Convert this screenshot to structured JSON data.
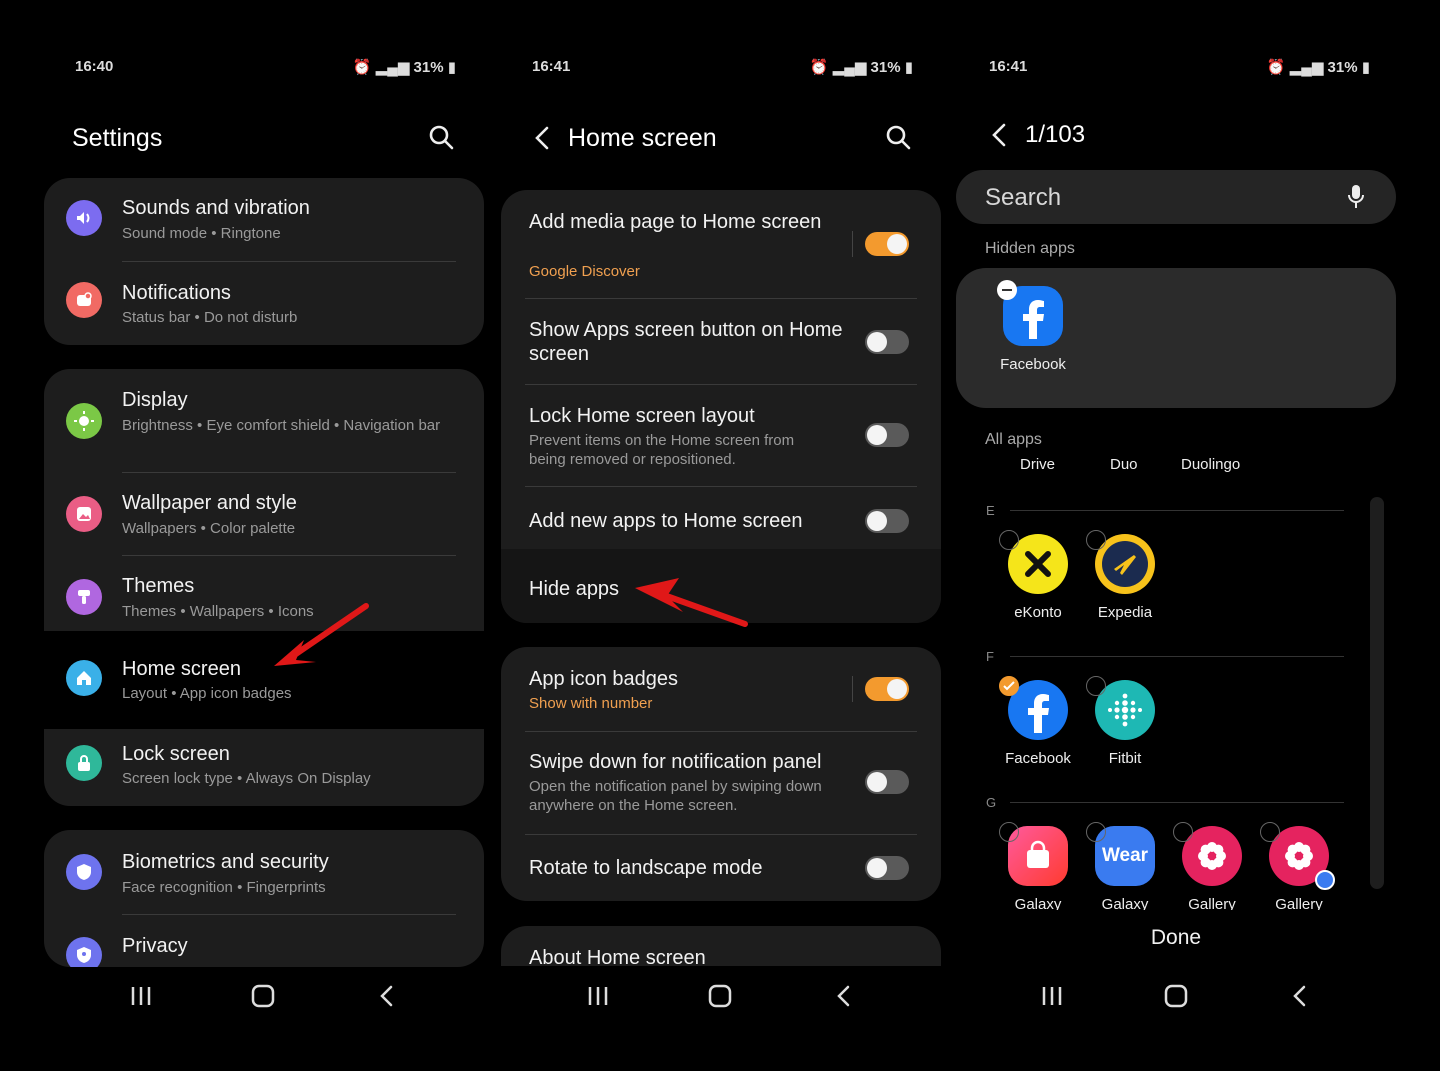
{
  "colors": {
    "accent_orange": "#f39a2e",
    "card_bg": "#1d1d1d",
    "subtext": "#9a9a9a"
  },
  "panel1": {
    "status": {
      "time": "16:40",
      "battery": "31%"
    },
    "title": "Settings",
    "groups": [
      [
        {
          "title": "Sounds and vibration",
          "sub": "Sound mode  •  Ringtone",
          "icon": "speaker-icon",
          "color": "#7c6cf0"
        },
        {
          "title": "Notifications",
          "sub": "Status bar  •  Do not disturb",
          "icon": "notification-icon",
          "color": "#f16a64"
        }
      ],
      [
        {
          "title": "Display",
          "sub": "Brightness  •  Eye comfort shield  •  Navigation bar",
          "icon": "sun-icon",
          "color": "#7bc846"
        },
        {
          "title": "Wallpaper and style",
          "sub": "Wallpapers  •  Color palette",
          "icon": "image-icon",
          "color": "#ea5d85"
        },
        {
          "title": "Themes",
          "sub": "Themes  •  Wallpapers  •  Icons",
          "icon": "brush-icon",
          "color": "#b067e0"
        },
        {
          "title": "Home screen",
          "sub": "Layout  •  App icon badges",
          "icon": "home-icon",
          "color": "#3ab0e8"
        },
        {
          "title": "Lock screen",
          "sub": "Screen lock type  •  Always On Display",
          "icon": "lock-icon",
          "color": "#2fb89a"
        }
      ],
      [
        {
          "title": "Biometrics and security",
          "sub": "Face recognition  •  Fingerprints",
          "icon": "shield-icon",
          "color": "#6e73ee"
        },
        {
          "title": "Privacy",
          "sub": "",
          "icon": "privacy-shield-icon",
          "color": "#6e73ee"
        }
      ]
    ]
  },
  "panel2": {
    "status": {
      "time": "16:41",
      "battery": "31%"
    },
    "title": "Home screen",
    "group1": [
      {
        "title": "Add media page to Home screen",
        "orange": "Google Discover",
        "toggle": true
      },
      {
        "title": "Show Apps screen button on Home screen",
        "toggle": false
      },
      {
        "title": "Lock Home screen layout",
        "sub": "Prevent items on the Home screen from being removed or repositioned.",
        "toggle": false
      },
      {
        "title": "Add new apps to Home screen",
        "toggle": false
      },
      {
        "title": "Hide apps"
      }
    ],
    "group2": [
      {
        "title": "App icon badges",
        "orange": "Show with number",
        "toggle": true
      },
      {
        "title": "Swipe down for notification panel",
        "sub": "Open the notification panel by swiping down anywhere on the Home screen.",
        "toggle": false
      },
      {
        "title": "Rotate to landscape mode",
        "toggle": false
      }
    ],
    "about": "About Home screen"
  },
  "panel3": {
    "status": {
      "time": "16:41",
      "battery": "31%"
    },
    "counter": "1/103",
    "search_placeholder": "Search",
    "hidden_label": "Hidden apps",
    "hidden_app": "Facebook",
    "all_label": "All apps",
    "top_apps": [
      "Drive",
      "Duo",
      "Duolingo"
    ],
    "sections": [
      {
        "letter": "E",
        "apps": [
          "eKonto",
          "Expedia"
        ]
      },
      {
        "letter": "F",
        "apps": [
          "Facebook",
          "Fitbit"
        ]
      },
      {
        "letter": "G",
        "apps": [
          "Galaxy",
          "Galaxy",
          "Gallery",
          "Gallery"
        ]
      }
    ],
    "wear_text": "Wear",
    "done": "Done"
  }
}
